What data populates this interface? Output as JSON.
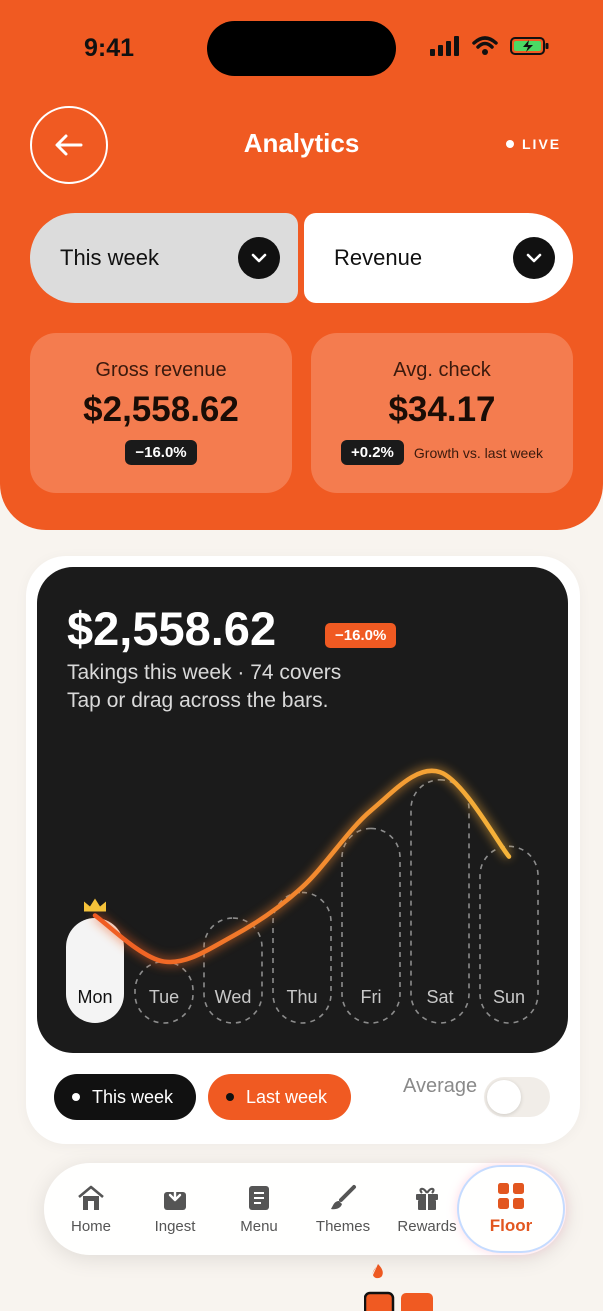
{
  "status": {
    "time": "9:41"
  },
  "header": {
    "title": "Analytics",
    "live_label": "LIVE"
  },
  "selectors": {
    "period": "This week",
    "metric": "Revenue"
  },
  "cards": [
    {
      "label": "Gross revenue",
      "value": "$2,558.62",
      "delta": "−16.0%",
      "note": ""
    },
    {
      "label": "Avg. check",
      "value": "$34.17",
      "delta": "+0.2%",
      "note": "Growth vs. last week"
    }
  ],
  "chart": {
    "total": "$2,558.62",
    "delta": "−16.0%",
    "subtitle": "Takings this week · 74 covers",
    "hint": "Tap or drag across the bars.",
    "selected_day": "Mon",
    "colors": {
      "accent": "#f05a22",
      "line_start": "#f05a22",
      "line_end": "#f5b43a",
      "crown": "#f5c23a"
    }
  },
  "chart_data": {
    "type": "bar",
    "categories": [
      "Mon",
      "Tue",
      "Wed",
      "Thu",
      "Fri",
      "Sat",
      "Sun"
    ],
    "series": [
      {
        "name": "This week",
        "values": [
          0.41,
          0.24,
          0.41,
          0.51,
          0.76,
          0.95,
          0.69
        ]
      },
      {
        "name": "Last week",
        "values": [
          0.42,
          0.24,
          0.34,
          0.53,
          0.83,
          0.98,
          0.65
        ]
      }
    ],
    "ylim": [
      0,
      1
    ],
    "grid": false,
    "legend": "bottom"
  },
  "toggles": {
    "this_week": "This week",
    "last_week": "Last week",
    "average": "Average"
  },
  "tabs": [
    {
      "label": "Home",
      "icon": "home-icon"
    },
    {
      "label": "Ingest",
      "icon": "ingest-icon"
    },
    {
      "label": "Menu",
      "icon": "menu-icon"
    },
    {
      "label": "Themes",
      "icon": "brush-icon"
    },
    {
      "label": "Rewards",
      "icon": "gift-icon"
    },
    {
      "label": "Floor",
      "icon": "floor-grid-icon"
    }
  ],
  "active_tab": "Floor"
}
